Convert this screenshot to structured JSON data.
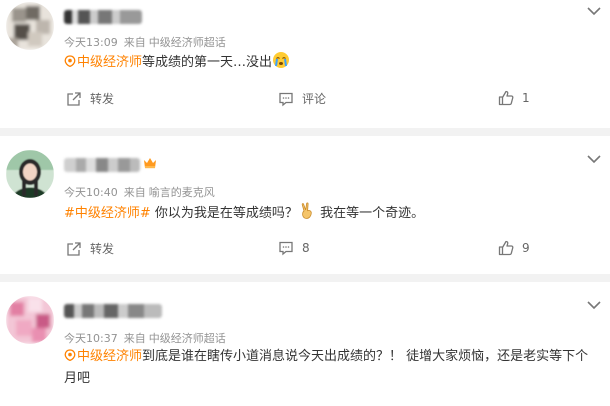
{
  "posts": [
    {
      "time": "今天13:09",
      "source_prefix": "来自",
      "source": "中级经济师超话",
      "topic": "中级经济师",
      "text": "等成绩的第一天…没出",
      "actions": {
        "repost": "转发",
        "comment": "评论",
        "likes": "1"
      }
    },
    {
      "time": "今天10:40",
      "source_prefix": "来自",
      "source": "喻言的麦克风",
      "topic": "#中级经济师#",
      "text_a": " 你以为我是在等成绩吗？",
      "text_b": " 我在等一个奇迹。",
      "actions": {
        "repost": "转发",
        "comment": "8",
        "likes": "9"
      }
    },
    {
      "time": "今天10:37",
      "source_prefix": "来自",
      "source": "中级经济师超话",
      "topic": "中级经济师",
      "text": "到底是谁在瞎传小道消息说今天出成绩的？！ 徒增大家烦恼，还是老实等下个月吧"
    }
  ],
  "colors": {
    "topic": "#ff8200",
    "meta": "#939393",
    "divider": "#f2f2f2"
  },
  "icons": [
    "topic-icon",
    "repost-icon",
    "comment-icon",
    "like-icon",
    "chevron-down-icon",
    "crying-emoji-icon",
    "victory-hand-emoji-icon",
    "vip-crown-icon"
  ]
}
